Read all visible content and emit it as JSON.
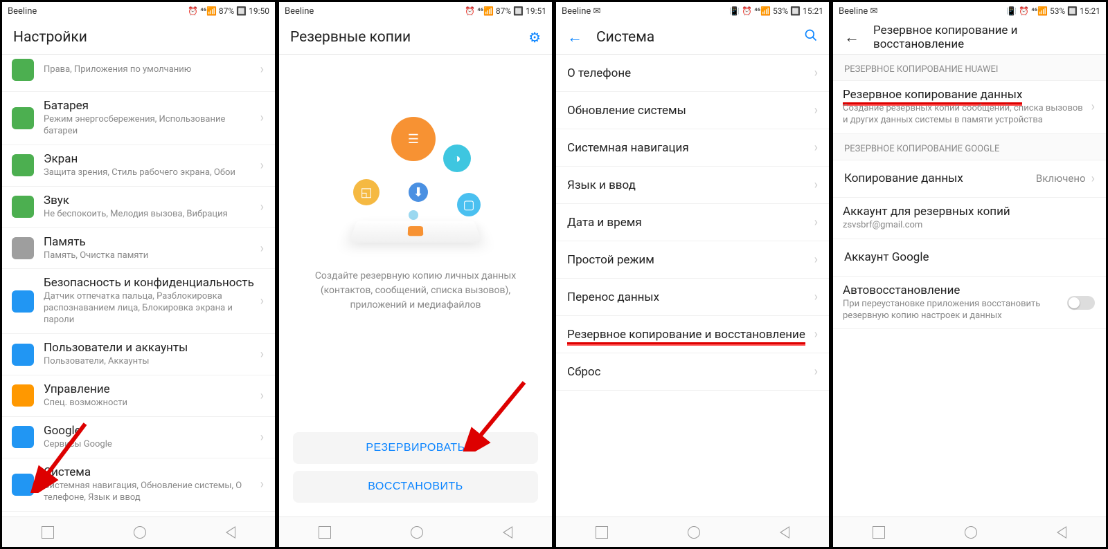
{
  "screen1": {
    "status": {
      "carrier": "Beeline",
      "right": "⏰ ⁴⁶📶 87% 🔲 19:50"
    },
    "title": "Настройки",
    "items": [
      {
        "title": "",
        "subtitle": "Права, Приложения по умолчанию",
        "color": "#4caf50",
        "cut": true
      },
      {
        "title": "Батарея",
        "subtitle": "Режим энергосбережения, Использование батареи",
        "color": "#4caf50"
      },
      {
        "title": "Экран",
        "subtitle": "Защита зрения, Стиль рабочего экрана, Обои",
        "color": "#4caf50"
      },
      {
        "title": "Звук",
        "subtitle": "Не беспокоить, Мелодия вызова, Вибрация",
        "color": "#4caf50"
      },
      {
        "title": "Память",
        "subtitle": "Память, Очистка памяти",
        "color": "#9e9e9e"
      },
      {
        "title": "Безопасность и конфиденциальность",
        "subtitle": "Датчик отпечатка пальца, Разблокировка распознаванием лица, Блокировка экрана и пароли",
        "color": "#2196f3"
      },
      {
        "title": "Пользователи и аккаунты",
        "subtitle": "Пользователи, Аккаунты",
        "color": "#2196f3"
      },
      {
        "title": "Управление",
        "subtitle": "Спец. возможности",
        "color": "#ff9800"
      },
      {
        "title": "Google",
        "subtitle": "Сервисы Google",
        "color": "#2196f3"
      },
      {
        "title": "Система",
        "subtitle": "Системная навигация, Обновление системы, О телефоне, Язык и ввод",
        "color": "#2196f3"
      }
    ]
  },
  "screen2": {
    "status": {
      "carrier": "Beeline",
      "right": "⏰ ⁴⁶📶 87% 🔲 19:51"
    },
    "title": "Резервные копии",
    "desc": "Создайте резервную копию личных данных (контактов, сообщений, списка вызовов), приложений и медиафайлов",
    "btn_backup": "РЕЗЕРВИРОВАТЬ",
    "btn_restore": "ВОССТАНОВИТЬ"
  },
  "screen3": {
    "status": {
      "carrier": "Beeline ✉",
      "right": "📳 ⏰ ⁴⁶📶 53% 🔲 15:21"
    },
    "title": "Система",
    "items": [
      {
        "title": "О телефоне"
      },
      {
        "title": "Обновление системы"
      },
      {
        "title": "Системная навигация"
      },
      {
        "title": "Язык и ввод"
      },
      {
        "title": "Дата и время"
      },
      {
        "title": "Простой режим"
      },
      {
        "title": "Перенос данных"
      },
      {
        "title": "Резервное копирование и восстановление",
        "underline": true
      },
      {
        "title": "Сброс"
      }
    ]
  },
  "screen4": {
    "status": {
      "carrier": "Beeline ✉",
      "right": "📳 ⏰ ⁴⁶📶 53% 🔲 15:21"
    },
    "title": "Резервное копирование и восстановление",
    "section1": "РЕЗЕРВНОЕ КОПИРОВАНИЕ HUAWEI",
    "item1": {
      "title": "Резервное копирование данных",
      "subtitle": "Создание резервных копий сообщений, списка вызовов и других данных системы в памяти устройства",
      "underline": true
    },
    "section2": "РЕЗЕРВНОЕ КОПИРОВАНИЕ GOOGLE",
    "item2": {
      "title": "Копирование данных",
      "value": "Включено"
    },
    "item3": {
      "title": "Аккаунт для резервных копий",
      "subtitle": "zsvsbrf@gmail.com"
    },
    "item4": {
      "title": "Аккаунт Google"
    },
    "item5": {
      "title": "Автовосстановление",
      "subtitle": "При переустановке приложения восстановить резервную копию настроек и данных"
    }
  }
}
